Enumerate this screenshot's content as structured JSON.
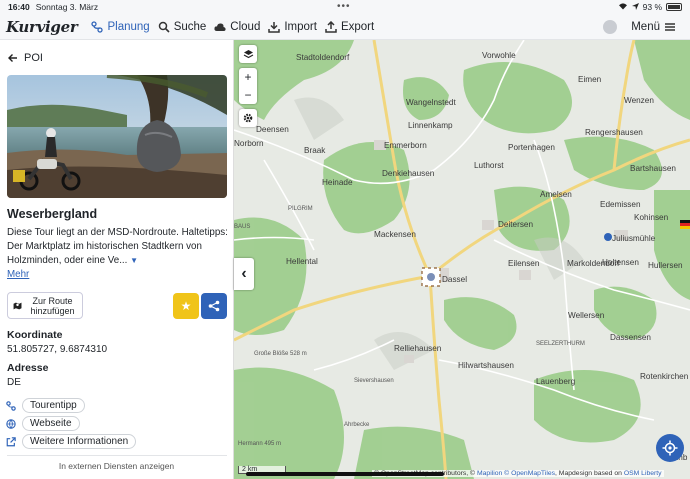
{
  "status_bar": {
    "time": "16:40",
    "date": "Sonntag 3. März",
    "battery": "93 %"
  },
  "app": {
    "logo": "Kurviger"
  },
  "nav": [
    {
      "label": "Planung",
      "icon": "route-icon",
      "active": true
    },
    {
      "label": "Suche",
      "icon": "search-icon"
    },
    {
      "label": "Cloud",
      "icon": "cloud-icon"
    },
    {
      "label": "Import",
      "icon": "import-icon"
    },
    {
      "label": "Export",
      "icon": "export-icon"
    }
  ],
  "menu_label": "Menü",
  "panel": {
    "back_label": "POI",
    "title": "Weserbergland",
    "description": "Diese Tour liegt an der MSD-Nordroute. Haltetipps: Der Marktplatz im historischen Stadtkern von Holzminden, oder eine Ve...",
    "more_label": "Mehr",
    "route_button": "Zur Route hinzufügen",
    "coords_label": "Koordinate",
    "coords_value": "51.805727, 9.6874310",
    "address_label": "Adresse",
    "address_value": "DE",
    "links": [
      {
        "label": "Tourentipp",
        "icon": "route-icon"
      },
      {
        "label": "Webseite",
        "icon": "globe-icon"
      },
      {
        "label": "Weitere Informationen",
        "icon": "external-link-icon"
      }
    ],
    "external_label": "In externen Diensten anzeigen"
  },
  "map": {
    "towns": [
      "Stadtoldendorf",
      "Vorwohle",
      "Eimen",
      "Wangelnstedt",
      "Linnenkamp",
      "Wenzen",
      "Deensen",
      "Emmerborn",
      "Portenhagen",
      "Rengershausen",
      "Norborn",
      "Braak",
      "Luthorst",
      "Bartshausen",
      "Heinade",
      "Denkiehausen",
      "Amelsen",
      "Edemissen",
      "Kohinsen",
      "Deitersen",
      "Mackensen",
      "Juliusmühle",
      "Hellental",
      "Eilensen",
      "Markoldendorf",
      "Holtensen",
      "Hullersen",
      "Dassel",
      "Wellersen",
      "Relliehausen",
      "Hilwartshausen",
      "Dassensen",
      "Lauenberg",
      "Rotenkirchen",
      "Sievershausen",
      "Ahrbecke",
      "Einb"
    ],
    "labels_small": [
      "PILGRIM",
      "Große Blöße 528 m",
      "SEELZERTHURM",
      "Hermann 495 m",
      "BAUS"
    ],
    "scale": "2 km",
    "attribution_prefix": "© OpenStreetMap contributors, ©",
    "attribution_links": [
      "Mapilion",
      "© OpenMapTiles"
    ],
    "attribution_middle": ", Mapdesign based on",
    "attribution_suffix": "OSM Liberty"
  }
}
